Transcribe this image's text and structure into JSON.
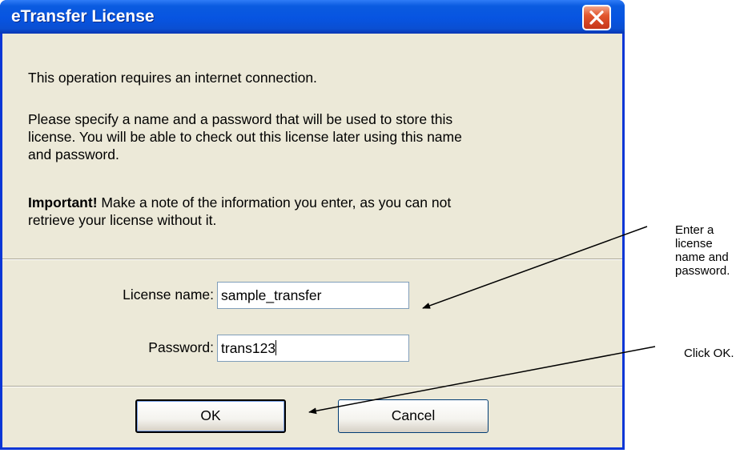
{
  "dialog": {
    "title": "eTransfer License",
    "close_label": "close",
    "intro_text": "This operation requires an internet connection.",
    "instruction_lines": [
      "Please specify a name and a password that will be used to store this",
      "license. You will be able to check out this license later using this name",
      "and password."
    ],
    "important_label": "Important!",
    "important_text": " Make a note of the information you enter, as you can not",
    "important_text_2": "retrieve your license without it.",
    "license_name_label": "License name:",
    "license_name_value": "sample_transfer",
    "password_label": "Password:",
    "password_value": "trans123",
    "ok_label": "OK",
    "cancel_label": "Cancel"
  },
  "annotations": {
    "name_password_lines": [
      "Enter a",
      "license",
      "name and",
      "password."
    ],
    "ok_note": "Click OK."
  },
  "colors": {
    "titlebar": "#0754e1",
    "dialog_bg": "#ece9d8",
    "close_button": "#e2562e"
  },
  "icons": {
    "close": "close-icon",
    "pointer_arrows": "arrow-icon"
  }
}
